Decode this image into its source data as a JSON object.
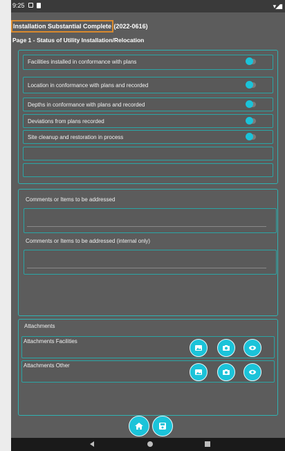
{
  "status_bar": {
    "time": "9:25",
    "signal": "▾◢▮"
  },
  "header": {
    "title_highlight": "Installation Substantial Complete",
    "title_suffix": " (2022-0616)",
    "subtitle": "Page 1 -  Status of Utility Installation/Relocation"
  },
  "checklist": {
    "items": [
      {
        "label": "Facilities installed in conformance with plans",
        "on": true
      },
      {
        "label": "Location in conformance with plans and recorded",
        "on": true
      },
      {
        "label": "Depths in conformance with plans and recorded",
        "on": true
      },
      {
        "label": "Deviations from plans recorded",
        "on": true
      },
      {
        "label": "Site cleanup and restoration in process",
        "on": true
      }
    ]
  },
  "comments": {
    "label": "Comments  or Items to be addressed",
    "internal_label": "Comments  or Items to be addressed  (internal only)"
  },
  "attachments": {
    "heading": "Attachments",
    "facilities_label": "Attachments  Facilities",
    "other_label": "Attachments Other"
  },
  "icons": {
    "gallery": "image-icon",
    "camera": "camera-icon",
    "view": "eye-icon",
    "home": "home-icon",
    "save": "save-icon"
  },
  "colors": {
    "accent": "#1bc3d9",
    "border": "#2fb3b3",
    "highlight": "#d98a2e"
  }
}
